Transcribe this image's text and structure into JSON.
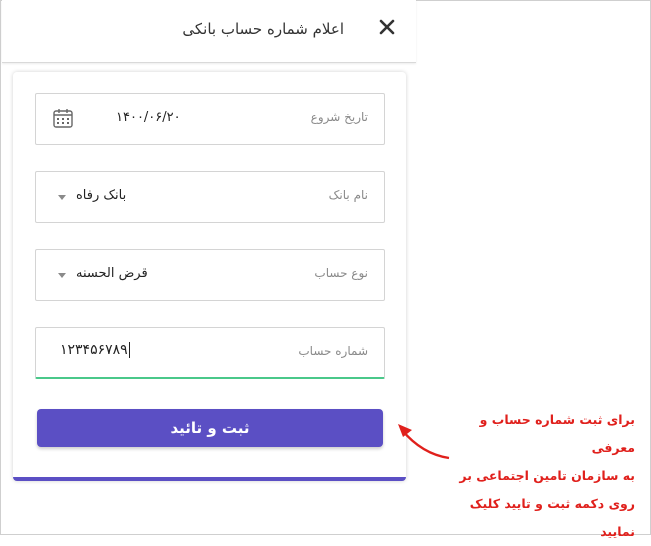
{
  "dialog": {
    "title": "اعلام شماره حساب بانکی",
    "close_icon": "close-icon"
  },
  "form": {
    "start_date": {
      "label": "تاریخ شروع",
      "value": "۱۴۰۰/۰۶/۲۰",
      "icon": "calendar-icon"
    },
    "bank_name": {
      "label": "نام بانک",
      "value": "بانک رفاه"
    },
    "account_type": {
      "label": "نوع حساب",
      "value": "قرض الحسنه"
    },
    "account_number": {
      "label": "شماره حساب",
      "value": "۱۲۳۴۵۶۷۸۹"
    },
    "submit_label": "ثبت و تائید"
  },
  "annotation": {
    "lines": [
      "برای ثبت شماره حساب و معرفی",
      "به سازمان تامین اجتماعی بر",
      "روی دکمه ثبت و تایید کلیک",
      "نمایید"
    ],
    "color": "#e0201c"
  },
  "colors": {
    "accent": "#5b4fc4",
    "active_underline": "#4ac88a"
  }
}
